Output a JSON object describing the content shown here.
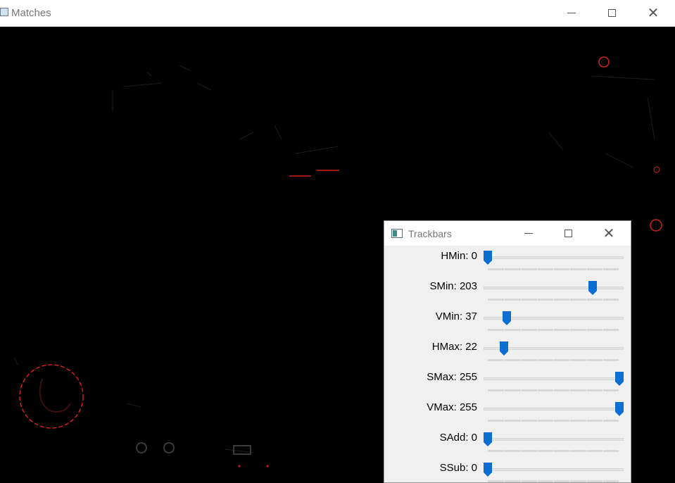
{
  "main_window": {
    "title": "Matches"
  },
  "trackbars_window": {
    "title": "Trackbars",
    "sliders": [
      {
        "label": "HMin: 0",
        "value": 0,
        "max": 179
      },
      {
        "label": "SMin: 203",
        "value": 203,
        "max": 255
      },
      {
        "label": "VMin: 37",
        "value": 37,
        "max": 255
      },
      {
        "label": "HMax: 22",
        "value": 22,
        "max": 179
      },
      {
        "label": "SMax: 255",
        "value": 255,
        "max": 255
      },
      {
        "label": "VMax: 255",
        "value": 255,
        "max": 255
      },
      {
        "label": "SAdd: 0",
        "value": 0,
        "max": 255
      },
      {
        "label": "SSub: 0",
        "value": 0,
        "max": 255
      }
    ]
  },
  "colors": {
    "thumb": "#0a6fd1",
    "detection": "#d0201a",
    "canvas": "#000000"
  },
  "icons": {
    "minimize": "minimize-icon",
    "maximize": "maximize-icon",
    "close": "close-icon"
  }
}
